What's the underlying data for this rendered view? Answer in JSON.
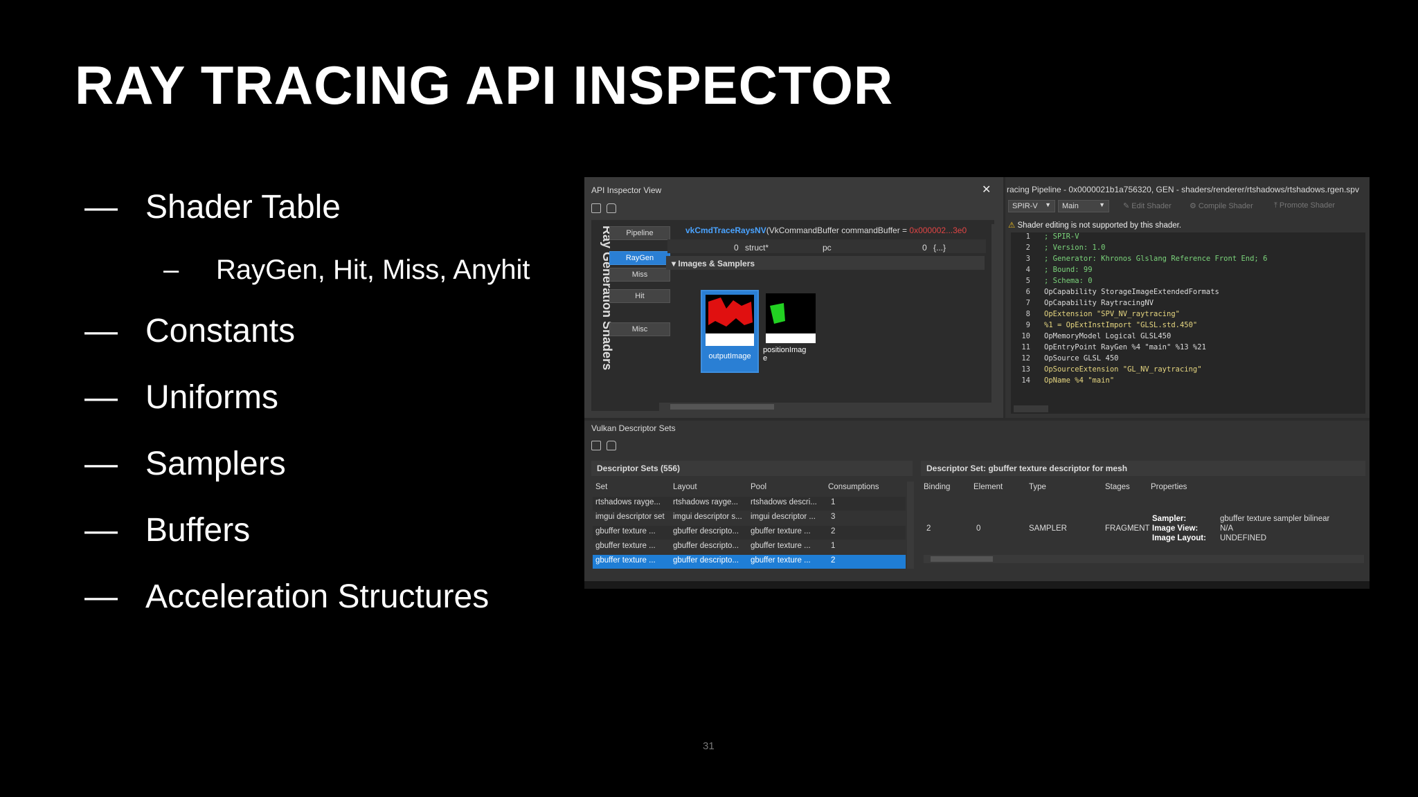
{
  "slide": {
    "title": "RAY TRACING API INSPECTOR",
    "page_number": "31",
    "bullets": [
      {
        "dash": "—",
        "text": "Shader Table"
      },
      {
        "dash": "–",
        "text": "RayGen, Hit, Miss, Anyhit"
      },
      {
        "dash": "—",
        "text": "Constants"
      },
      {
        "dash": "—",
        "text": "Uniforms"
      },
      {
        "dash": "—",
        "text": "Samplers"
      },
      {
        "dash": "—",
        "text": "Buffers"
      },
      {
        "dash": "—",
        "text": "Acceleration Structures"
      }
    ]
  },
  "api_inspector": {
    "title": "API Inspector View",
    "close": "✕",
    "vertical_label": "Ray Generation Shaders",
    "side_buttons": [
      "Pipeline",
      "RayGen",
      "Miss",
      "Hit",
      "Misc"
    ],
    "active_button": "RayGen",
    "function_name": "vkCmdTraceRaysNV",
    "function_args": "(VkCommandBuffer commandBuffer = ",
    "function_ptr": "0x000002...3e0",
    "struct_row": {
      "count": "0",
      "type": "struct*",
      "name": "pc",
      "index": "0",
      "value": "{...}"
    },
    "section": "Images & Samplers",
    "thumbnails": [
      "outputImage",
      "positionImag\ne"
    ]
  },
  "shader_view": {
    "title": "racing Pipeline - 0x0000021b1a756320, GEN - shaders/renderer/rtshadows/rtshadows.rgen.spv",
    "format_select": "SPIR-V",
    "entry_select": "Main",
    "toolbar": [
      "Edit Shader",
      "Compile Shader",
      "Promote Shader"
    ],
    "warning": "Shader editing is not supported by this shader.",
    "code": [
      {
        "n": "1",
        "t": "; SPIR-V"
      },
      {
        "n": "2",
        "t": "; Version: 1.0"
      },
      {
        "n": "3",
        "t": "; Generator: Khronos Glslang Reference Front End; 6"
      },
      {
        "n": "4",
        "t": "; Bound: 99"
      },
      {
        "n": "5",
        "t": "; Schema: 0"
      },
      {
        "n": "6",
        "t": "OpCapability StorageImageExtendedFormats"
      },
      {
        "n": "7",
        "t": "OpCapability RaytracingNV"
      },
      {
        "n": "8",
        "t": "OpExtension \"SPV_NV_raytracing\""
      },
      {
        "n": "9",
        "t": "%1 = OpExtInstImport \"GLSL.std.450\""
      },
      {
        "n": "10",
        "t": "OpMemoryModel Logical GLSL450"
      },
      {
        "n": "11",
        "t": "OpEntryPoint RayGen %4 \"main\" %13 %21"
      },
      {
        "n": "12",
        "t": "OpSource GLSL 450"
      },
      {
        "n": "13",
        "t": "OpSourceExtension \"GL_NV_raytracing\""
      },
      {
        "n": "14",
        "t": "OpName %4 \"main\""
      }
    ]
  },
  "descriptor_sets": {
    "title": "Vulkan Descriptor Sets",
    "left_header": "Descriptor Sets (556)",
    "columns": [
      "Set",
      "Layout",
      "Pool",
      "Consumptions"
    ],
    "rows": [
      [
        "rtshadows rayge...",
        "rtshadows rayge...",
        "rtshadows descri...",
        "1"
      ],
      [
        "imgui descriptor set",
        "imgui descriptor s...",
        "imgui descriptor ...",
        "3"
      ],
      [
        "gbuffer texture ...",
        "gbuffer descripto...",
        "gbuffer texture ...",
        "2"
      ],
      [
        "gbuffer texture ...",
        "gbuffer descripto...",
        "gbuffer texture ...",
        "1"
      ],
      [
        "gbuffer texture ...",
        "gbuffer descripto...",
        "gbuffer texture ...",
        "2"
      ]
    ],
    "right_header": "Descriptor Set: gbuffer texture descriptor for mesh",
    "right_columns": [
      "Binding",
      "Element",
      "Type",
      "Stages",
      "Properties"
    ],
    "binding_row": {
      "binding": "2",
      "element": "0",
      "type": "SAMPLER",
      "stages": "FRAGMENT"
    },
    "properties": [
      {
        "k": "Sampler:",
        "v": "gbuffer texture sampler bilinear"
      },
      {
        "k": "Image View:",
        "v": "N/A"
      },
      {
        "k": "Image Layout:",
        "v": "UNDEFINED"
      }
    ]
  }
}
